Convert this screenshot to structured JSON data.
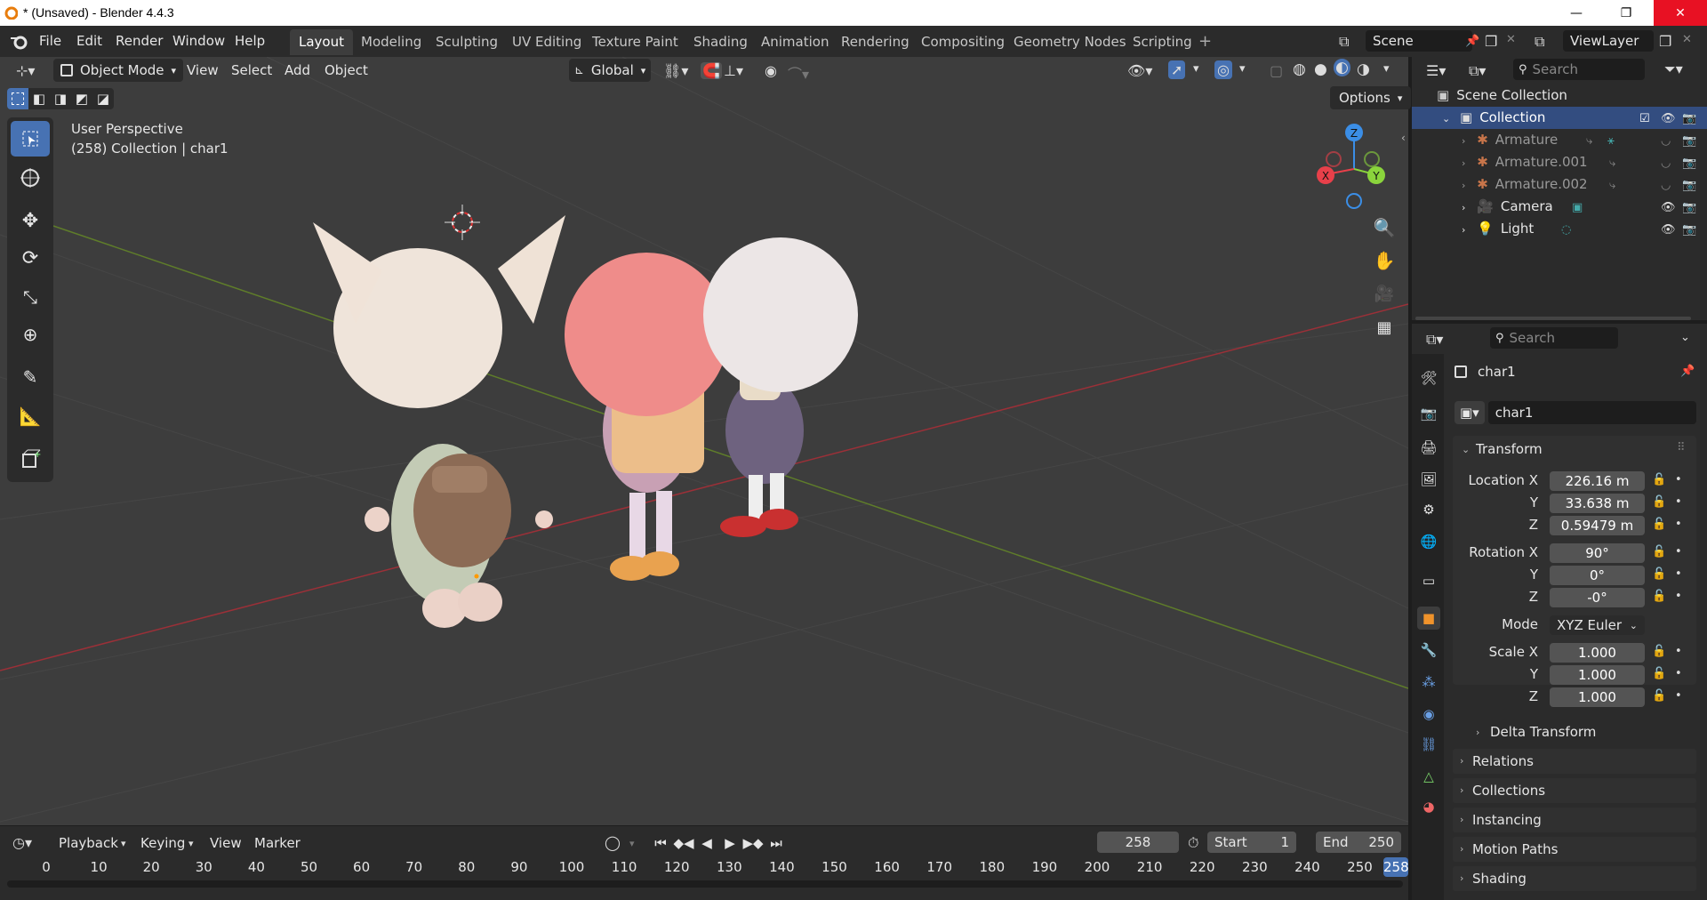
{
  "window": {
    "title": "* (Unsaved) - Blender 4.4.3"
  },
  "menu": [
    "File",
    "Edit",
    "Render",
    "Window",
    "Help"
  ],
  "workspaces": [
    "Layout",
    "Modeling",
    "Sculpting",
    "UV Editing",
    "Texture Paint",
    "Shading",
    "Animation",
    "Rendering",
    "Compositing",
    "Geometry Nodes",
    "Scripting"
  ],
  "active_workspace": "Layout",
  "scene": "Scene",
  "view_layer": "ViewLayer",
  "viewport": {
    "mode": "Object Mode",
    "menus": [
      "View",
      "Select",
      "Add",
      "Object"
    ],
    "orientation": "Global",
    "options": "Options",
    "info_line1": "User Perspective",
    "info_line2": "(258) Collection | char1",
    "gizmo": {
      "x": "X",
      "y": "Y",
      "z": "Z"
    }
  },
  "timeline": {
    "menus": [
      "Playback",
      "Keying",
      "View",
      "Marker"
    ],
    "current_frame": "258",
    "start_label": "Start",
    "start": "1",
    "end_label": "End",
    "end": "250",
    "ticks": [
      "0",
      "10",
      "20",
      "30",
      "40",
      "50",
      "60",
      "70",
      "80",
      "90",
      "100",
      "110",
      "120",
      "130",
      "140",
      "150",
      "160",
      "170",
      "180",
      "190",
      "200",
      "210",
      "220",
      "230",
      "240",
      "250"
    ],
    "playhead": "258"
  },
  "outliner": {
    "search_placeholder": "Search",
    "root": "Scene Collection",
    "collection": "Collection",
    "items": [
      "Armature",
      "Armature.001",
      "Armature.002",
      "Camera",
      "Light"
    ]
  },
  "properties": {
    "search_placeholder": "Search",
    "object_name": "char1",
    "object_field": "char1",
    "transform_title": "Transform",
    "location_label": "Location X",
    "rotation_label": "Rotation X",
    "scale_label": "Scale X",
    "y_label": "Y",
    "z_label": "Z",
    "location": [
      "226.16 m",
      "33.638 m",
      "0.59479 m"
    ],
    "rotation": [
      "90°",
      "0°",
      "-0°"
    ],
    "mode_label": "Mode",
    "mode": "XYZ Euler",
    "scale": [
      "1.000",
      "1.000",
      "1.000"
    ],
    "panels": [
      "Delta Transform",
      "Relations",
      "Collections",
      "Instancing",
      "Motion Paths",
      "Shading"
    ]
  },
  "colors": {
    "accent": "#4772b3",
    "x_axis": "#e8404a",
    "y_axis": "#8ad43c",
    "z_axis": "#3b8ee6"
  }
}
